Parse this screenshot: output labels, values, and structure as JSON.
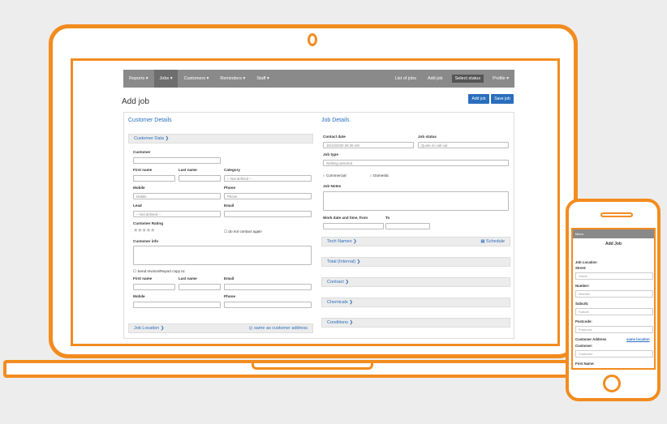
{
  "nav": {
    "items": [
      "Reports ▾",
      "Jobs ▾",
      "Customers ▾",
      "Reminders ▾",
      "Staff ▾"
    ],
    "list_jobs": "List of jobs",
    "add_job": "Add job",
    "select_status": "Select status",
    "profile": "Profile ▾"
  },
  "page": {
    "title": "Add job",
    "add_job_button": "Add job",
    "save_job_button": "Save job"
  },
  "customer": {
    "section_title": "Customer Details",
    "customer_data": "Customer Data ❯",
    "customer": "Customer",
    "first_name": "First name",
    "last_name": "Last name",
    "category": "Category",
    "category_value": "-- Not defined --",
    "mobile": "Mobile",
    "mobile_ph": "Mobile",
    "phone": "Phone",
    "phone_ph": "Phone",
    "lead": "Lead",
    "lead_value": "-- Not defined --",
    "email": "Email",
    "rating": "Customer Rating",
    "stars": "★★★★★",
    "no_contact": "do not contact again",
    "info": "Customer info",
    "send_invoice": "Send Invoice/Report copy to:",
    "first_name2": "First name",
    "last_name2": "Last name",
    "email2": "Email",
    "mobile2": "Mobile",
    "phone2": "Phone",
    "job_location": "Job Location ❯",
    "same_as": "◎ same as customer address"
  },
  "job": {
    "section_title": "Job Details",
    "contact_date": "Contact date",
    "contact_date_value": "15/10/2020 06:30 AM",
    "job_status": "Job status",
    "job_status_value": "Quote no call out",
    "job_type": "Job type",
    "job_type_value": "Nothing selected",
    "commercial": "Commercial",
    "domestic": "Domestic",
    "job_notes": "Job Notes",
    "work_date": "Work date and time, from",
    "to": "To",
    "tech_names": "Tech Names ❯",
    "schedule": "▦ Schedule",
    "total": "Total (Internal) ❯",
    "contract": "Contract ❯",
    "chemicals": "Chemicals ❯",
    "conditions": "Conditions ❯"
  },
  "phone": {
    "bar": "Menu",
    "title": "Add Job",
    "job_location": "Job Location",
    "street": "Street:",
    "street_ph": "Street",
    "number": "Number:",
    "number_ph": "Number",
    "suburb": "Suburb:",
    "suburb_ph": "Suburb",
    "postcode": "Postcode:",
    "postcode_ph": "Postcode",
    "customer_address": "Customer Address",
    "same_location": "same location",
    "customer": "Customer:",
    "customer_ph": "Customer",
    "first_name": "First Name:"
  },
  "colors": {
    "accent": "#f28c1f",
    "brand": "#2a6ebd",
    "nav": "#8a8a8a"
  }
}
